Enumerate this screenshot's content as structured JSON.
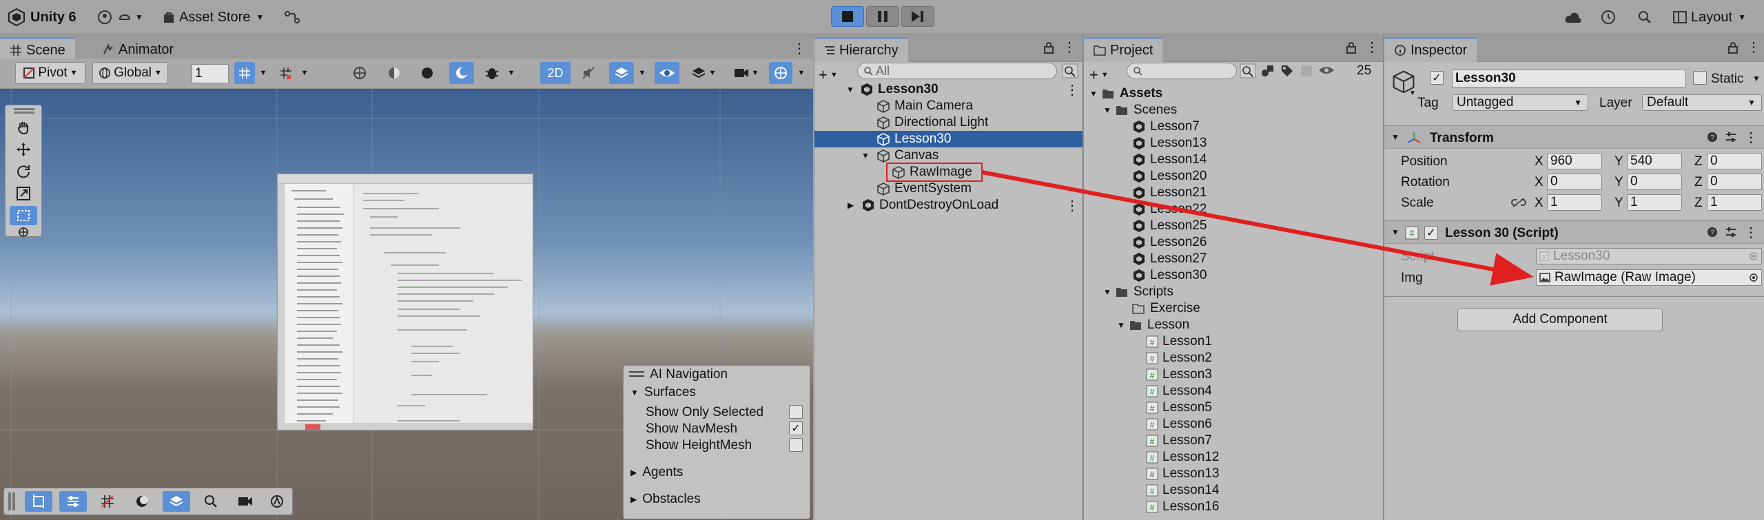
{
  "topbar": {
    "app_title": "Unity 6",
    "asset_store": "Asset Store",
    "layout": "Layout"
  },
  "scene_panel": {
    "tabs": [
      "Scene",
      "Animator"
    ],
    "pivot": "Pivot",
    "global": "Global",
    "grid_value": "1",
    "mode_2d": "2D"
  },
  "ai_navigation": {
    "title": "AI Navigation",
    "surfaces": "Surfaces",
    "options": [
      {
        "label": "Show Only Selected",
        "checked": false
      },
      {
        "label": "Show NavMesh",
        "checked": true
      },
      {
        "label": "Show HeightMesh",
        "checked": false
      }
    ],
    "agents": "Agents",
    "obstacles": "Obstacles"
  },
  "hierarchy": {
    "tab": "Hierarchy",
    "search_placeholder": "All",
    "items": [
      {
        "label": "Lesson30",
        "level": 0,
        "scene": true
      },
      {
        "label": "Main Camera",
        "level": 1
      },
      {
        "label": "Directional Light",
        "level": 1
      },
      {
        "label": "Lesson30",
        "level": 1,
        "selected": true
      },
      {
        "label": "Canvas",
        "level": 1,
        "expanded": true
      },
      {
        "label": "RawImage",
        "level": 2,
        "highlighted": true
      },
      {
        "label": "EventSystem",
        "level": 1
      },
      {
        "label": "DontDestroyOnLoad",
        "level": 0,
        "scene": true
      }
    ]
  },
  "project": {
    "tab": "Project",
    "count": "25",
    "assets": "Assets",
    "scenes_folder": "Scenes",
    "scenes": [
      "Lesson7",
      "Lesson13",
      "Lesson14",
      "Lesson20",
      "Lesson21",
      "Lesson22",
      "Lesson25",
      "Lesson26",
      "Lesson27",
      "Lesson30"
    ],
    "scripts_folder": "Scripts",
    "exercise_folder": "Exercise",
    "lesson_folder": "Lesson",
    "scripts": [
      "Lesson1",
      "Lesson2",
      "Lesson3",
      "Lesson4",
      "Lesson5",
      "Lesson6",
      "Lesson7",
      "Lesson12",
      "Lesson13",
      "Lesson14",
      "Lesson16"
    ]
  },
  "inspector": {
    "tab": "Inspector",
    "object_name": "Lesson30",
    "static_label": "Static",
    "tag_label": "Tag",
    "tag_value": "Untagged",
    "layer_label": "Layer",
    "layer_value": "Default",
    "transform": {
      "title": "Transform",
      "position_label": "Position",
      "rotation_label": "Rotation",
      "scale_label": "Scale",
      "position": [
        "960",
        "540",
        "0"
      ],
      "rotation": [
        "0",
        "0",
        "0"
      ],
      "scale": [
        "1",
        "1",
        "1"
      ],
      "axis": [
        "X",
        "Y",
        "Z"
      ]
    },
    "script_component": {
      "title": "Lesson 30 (Script)",
      "script_label": "Script",
      "script_value": "Lesson30",
      "img_label": "Img",
      "img_value": "RawImage (Raw Image)"
    },
    "add_component": "Add Component"
  },
  "colors": {
    "accent": "#5b8fd6",
    "selection": "#2d5fa0",
    "annotation_red": "#e02020"
  }
}
